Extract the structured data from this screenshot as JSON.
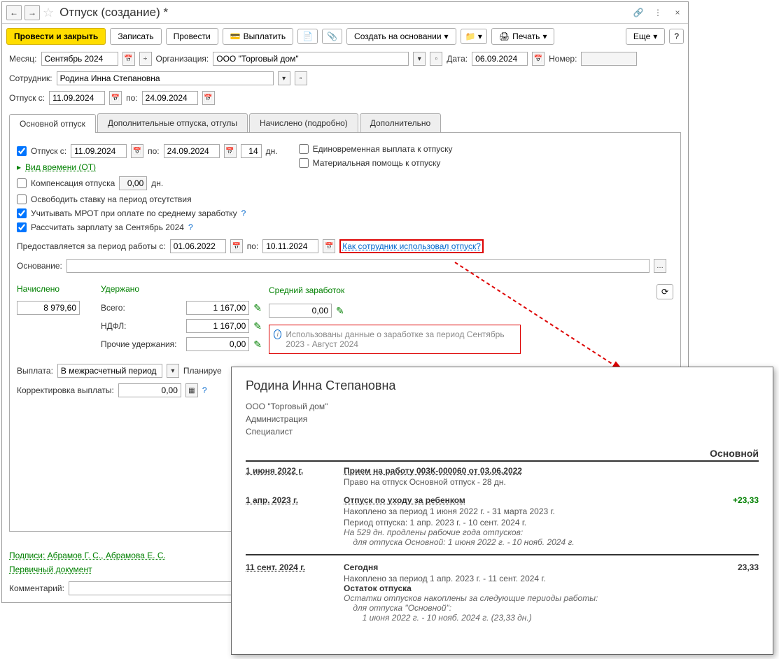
{
  "titlebar": {
    "title": "Отпуск (создание) *",
    "back": "←",
    "forward": "→",
    "star": "☆",
    "link": "🔗",
    "more": "⋮",
    "close": "×"
  },
  "toolbar": {
    "post_close": "Провести и закрыть",
    "save": "Записать",
    "post": "Провести",
    "pay": "Выплатить",
    "create_from": "Создать на основании",
    "print": "Печать",
    "more": "Еще",
    "help": "?"
  },
  "header": {
    "month_label": "Месяц:",
    "month": "Сентябрь 2024",
    "org_label": "Организация:",
    "org": "ООО \"Торговый дом\"",
    "date_label": "Дата:",
    "date": "06.09.2024",
    "number_label": "Номер:",
    "number": "",
    "employee_label": "Сотрудник:",
    "employee": "Родина Инна Степановна",
    "vacation_from_label": "Отпуск с:",
    "vacation_from": "11.09.2024",
    "vacation_to_label": "по:",
    "vacation_to": "24.09.2024"
  },
  "tabs": {
    "main": "Основной отпуск",
    "additional": "Дополнительные отпуска, отгулы",
    "accrued": "Начислено (подробно)",
    "extra": "Дополнительно"
  },
  "main_tab": {
    "vacation_check": "Отпуск  с:",
    "from": "11.09.2024",
    "to_label": "по:",
    "to": "24.09.2024",
    "days": "14",
    "days_suffix": "дн.",
    "time_type": "Вид времени (ОТ)",
    "lump_sum": "Единовременная выплата к отпуску",
    "material_aid": "Материальная помощь к отпуску",
    "compensation": "Компенсация отпуска",
    "comp_days": "0,00",
    "comp_suffix": "дн.",
    "release_position": "Освободить ставку на период отсутствия",
    "mrot": "Учитывать МРОТ при оплате по среднему заработку",
    "calc_salary": "Рассчитать зарплату за Сентябрь 2024",
    "period_label": "Предоставляется за период работы с:",
    "period_from": "01.06.2022",
    "period_to_label": "по:",
    "period_to": "10.11.2024",
    "usage_link": "Как сотрудник использовал отпуск?",
    "basis_label": "Основание:"
  },
  "accrual": {
    "accrued_label": "Начислено",
    "withheld_label": "Удержано",
    "avg_label": "Средний заработок",
    "accrued": "8 979,60",
    "total_label": "Всего:",
    "total": "1 167,00",
    "avg": "0,00",
    "ndfl_label": "НДФЛ:",
    "ndfl": "1 167,00",
    "other_label": "Прочие удержания:",
    "other": "0,00",
    "refresh": "⟳",
    "info": "Использованы данные о заработке за период Сентябрь 2023 - Август 2024"
  },
  "payment": {
    "label": "Выплата:",
    "value": "В межрасчетный период",
    "plan_label": "Планируе",
    "correction_label": "Корректировка выплаты:",
    "correction": "0,00"
  },
  "footer": {
    "signatures": "Подписи: Абрамов Г. С., Абрамова Е. С.",
    "primary_doc": "Первичный документ",
    "comment_label": "Комментарий:"
  },
  "popup": {
    "name": "Родина Инна Степановна",
    "org": "ООО \"Торговый дом\"",
    "dept": "Администрация",
    "position": "Специалист",
    "section": "Основной",
    "rows": [
      {
        "date": "1 июня 2022 г.",
        "title": "Прием на работу 003К-000060 от 03.06.2022",
        "details": [
          "Право на отпуск Основной отпуск - 28 дн."
        ],
        "value": ""
      },
      {
        "date": "1 апр. 2023 г.",
        "title": "Отпуск по уходу за ребенком",
        "details": [
          "Накоплено за период 1 июня 2022 г. - 31 марта 2023 г.",
          "Период отпуска: 1 апр. 2023 г. - 10 сент. 2024 г."
        ],
        "italic": [
          "На 529 дн. продлены рабочие года отпусков:",
          "    для отпуска Основной: 1 июня 2022 г. - 10 нояб. 2024 г."
        ],
        "value": "+23,33"
      },
      {
        "date": "11 сент. 2024 г.",
        "title_plain": "Сегодня",
        "details": [
          "Накоплено за период 1 апр. 2023 г. - 11 сент. 2024 г."
        ],
        "bold2": "Остаток отпуска",
        "italic": [
          "Остатки отпусков накоплены за следующие периоды работы:",
          "    для отпуска \"Основной\":",
          "        1 июня 2022 г. - 10 нояб. 2024 г. (23,33 дн.)"
        ],
        "value_black": "23,33"
      }
    ]
  }
}
